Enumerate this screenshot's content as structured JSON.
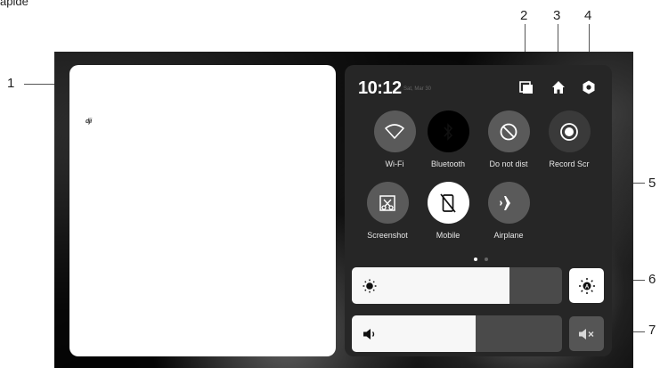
{
  "page_caption_partial": "apide",
  "callouts": [
    "1",
    "2",
    "3",
    "4",
    "5",
    "6",
    "7"
  ],
  "status": {
    "time": "10:12",
    "date": "Sat, Mar 30"
  },
  "app": {
    "logo_text": "dji"
  },
  "header_icons": [
    "recent-apps-icon",
    "home-icon",
    "settings-hex-icon"
  ],
  "tiles": [
    {
      "label": "Wi-Fi",
      "icon": "wifi-icon",
      "state": "off"
    },
    {
      "label": "Bluetooth",
      "icon": "bluetooth-icon",
      "state": "off"
    },
    {
      "label": "Do not dist",
      "icon": "do-not-disturb-icon",
      "state": "off"
    },
    {
      "label": "Record Scr",
      "icon": "record-screen-icon",
      "state": "off"
    },
    {
      "label": "Screenshot",
      "icon": "screenshot-icon",
      "state": "off"
    },
    {
      "label": "Mobile",
      "icon": "mobile-data-off-icon",
      "state": "on"
    },
    {
      "label": "Airplane",
      "icon": "airplane-icon",
      "state": "off"
    }
  ],
  "page_indicator": {
    "pages": 2,
    "current": 1
  },
  "brightness": {
    "level_percent": 75,
    "icon": "brightness-icon",
    "auto_icon": "auto-brightness-icon",
    "auto_on": true
  },
  "volume": {
    "level_percent": 59,
    "icon": "volume-icon",
    "mute_icon": "mute-icon"
  },
  "colors": {
    "panel": "#262626",
    "tile": "#5a5a5a",
    "tile_active": "#ffffff",
    "slider_fill": "#f7f7f7",
    "slider_track": "#4a4a4a"
  }
}
